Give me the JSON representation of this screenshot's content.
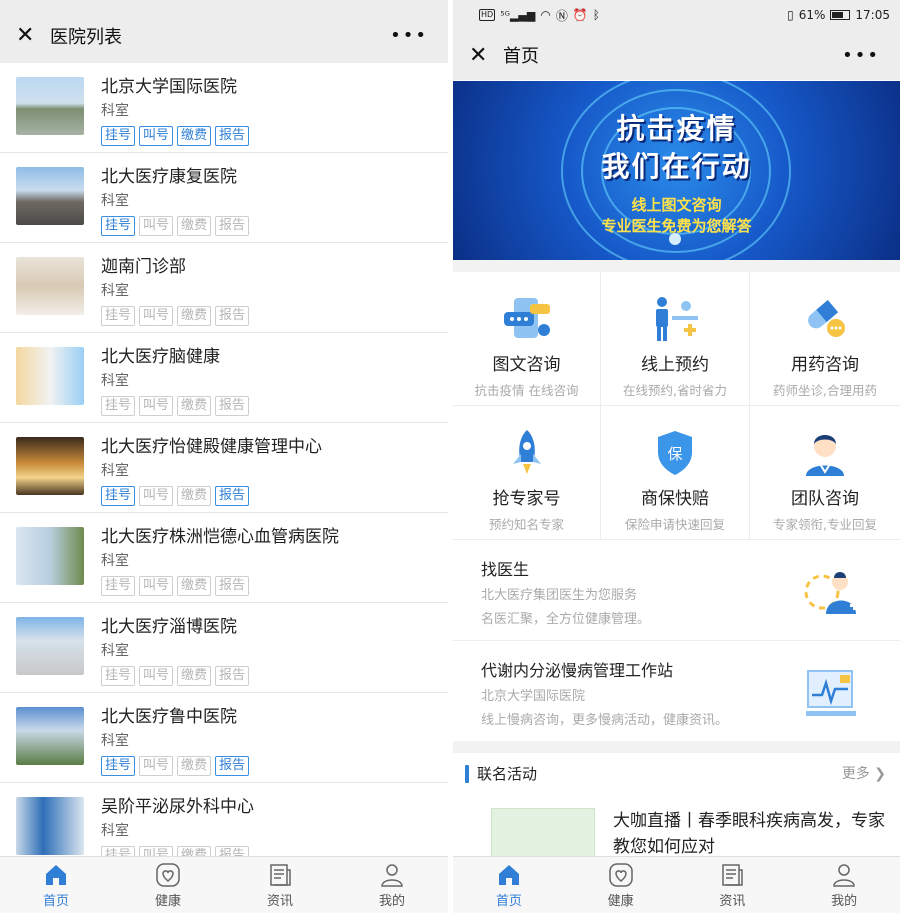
{
  "left": {
    "title": "医院列表",
    "hospitals": [
      {
        "name": "北京大学国际医院",
        "sub": "科室",
        "tags": [
          {
            "label": "挂号",
            "active": true
          },
          {
            "label": "叫号",
            "active": true
          },
          {
            "label": "缴费",
            "active": true
          },
          {
            "label": "报告",
            "active": true
          }
        ]
      },
      {
        "name": "北大医疗康复医院",
        "sub": "科室",
        "tags": [
          {
            "label": "挂号",
            "active": true
          },
          {
            "label": "叫号",
            "active": false
          },
          {
            "label": "缴费",
            "active": false
          },
          {
            "label": "报告",
            "active": false
          }
        ]
      },
      {
        "name": "迦南门诊部",
        "sub": "科室",
        "tags": [
          {
            "label": "挂号",
            "active": false
          },
          {
            "label": "叫号",
            "active": false
          },
          {
            "label": "缴费",
            "active": false
          },
          {
            "label": "报告",
            "active": false
          }
        ]
      },
      {
        "name": "北大医疗脑健康",
        "sub": "科室",
        "tags": [
          {
            "label": "挂号",
            "active": false
          },
          {
            "label": "叫号",
            "active": false
          },
          {
            "label": "缴费",
            "active": false
          },
          {
            "label": "报告",
            "active": false
          }
        ]
      },
      {
        "name": "北大医疗怡健殿健康管理中心",
        "sub": "科室",
        "tags": [
          {
            "label": "挂号",
            "active": true
          },
          {
            "label": "叫号",
            "active": false
          },
          {
            "label": "缴费",
            "active": false
          },
          {
            "label": "报告",
            "active": true
          }
        ]
      },
      {
        "name": "北大医疗株洲恺德心血管病医院",
        "sub": "科室",
        "tags": [
          {
            "label": "挂号",
            "active": false
          },
          {
            "label": "叫号",
            "active": false
          },
          {
            "label": "缴费",
            "active": false
          },
          {
            "label": "报告",
            "active": false
          }
        ]
      },
      {
        "name": "北大医疗淄博医院",
        "sub": "科室",
        "tags": [
          {
            "label": "挂号",
            "active": false
          },
          {
            "label": "叫号",
            "active": false
          },
          {
            "label": "缴费",
            "active": false
          },
          {
            "label": "报告",
            "active": false
          }
        ]
      },
      {
        "name": "北大医疗鲁中医院",
        "sub": "科室",
        "tags": [
          {
            "label": "挂号",
            "active": true
          },
          {
            "label": "叫号",
            "active": false
          },
          {
            "label": "缴费",
            "active": false
          },
          {
            "label": "报告",
            "active": true
          }
        ]
      },
      {
        "name": "吴阶平泌尿外科中心",
        "sub": "科室",
        "tags": [
          {
            "label": "挂号",
            "active": false
          },
          {
            "label": "叫号",
            "active": false
          },
          {
            "label": "缴费",
            "active": false
          },
          {
            "label": "报告",
            "active": false
          }
        ]
      }
    ]
  },
  "right": {
    "status": {
      "battery": "61%",
      "time": "17:05"
    },
    "title": "首页",
    "banner": {
      "line1": "抗击疫情",
      "line2": "我们在行动",
      "line3": "线上图文咨询",
      "line4": "专业医生免费为您解答"
    },
    "services": [
      {
        "label": "图文咨询",
        "sub": "抗击疫情 在线咨询",
        "icon": "chat-phone-icon"
      },
      {
        "label": "线上预约",
        "sub": "在线预约,省时省力",
        "icon": "appointment-icon"
      },
      {
        "label": "用药咨询",
        "sub": "药师坐诊,合理用药",
        "icon": "pill-icon"
      },
      {
        "label": "抢专家号",
        "sub": "预约知名专家",
        "icon": "rocket-icon"
      },
      {
        "label": "商保快赔",
        "sub": "保险申请快速回复",
        "icon": "insurance-shield-icon"
      },
      {
        "label": "团队咨询",
        "sub": "专家领衔,专业回复",
        "icon": "doctor-icon"
      }
    ],
    "find_doctor": {
      "title": "找医生",
      "line1": "北大医疗集团医生为您服务",
      "line2": "名医汇聚，全方位健康管理。"
    },
    "metabolic": {
      "title": "代谢内分泌慢病管理工作站",
      "line1": "北京大学国际医院",
      "line2": "线上慢病咨询，更多慢病活动，健康资讯。"
    },
    "section": {
      "title": "联名活动",
      "more": "更多"
    },
    "article": {
      "title": "大咖直播丨春季眼科疾病高发，专家教您如何应对"
    }
  },
  "tabs": [
    {
      "label": "首页",
      "icon": "home-icon"
    },
    {
      "label": "健康",
      "icon": "heart-icon"
    },
    {
      "label": "资讯",
      "icon": "news-icon"
    },
    {
      "label": "我的",
      "icon": "user-icon"
    }
  ],
  "colors": {
    "accent": "#2f7fd6",
    "tag_inactive": "#b5b5b5",
    "banner": "#1659c9"
  }
}
